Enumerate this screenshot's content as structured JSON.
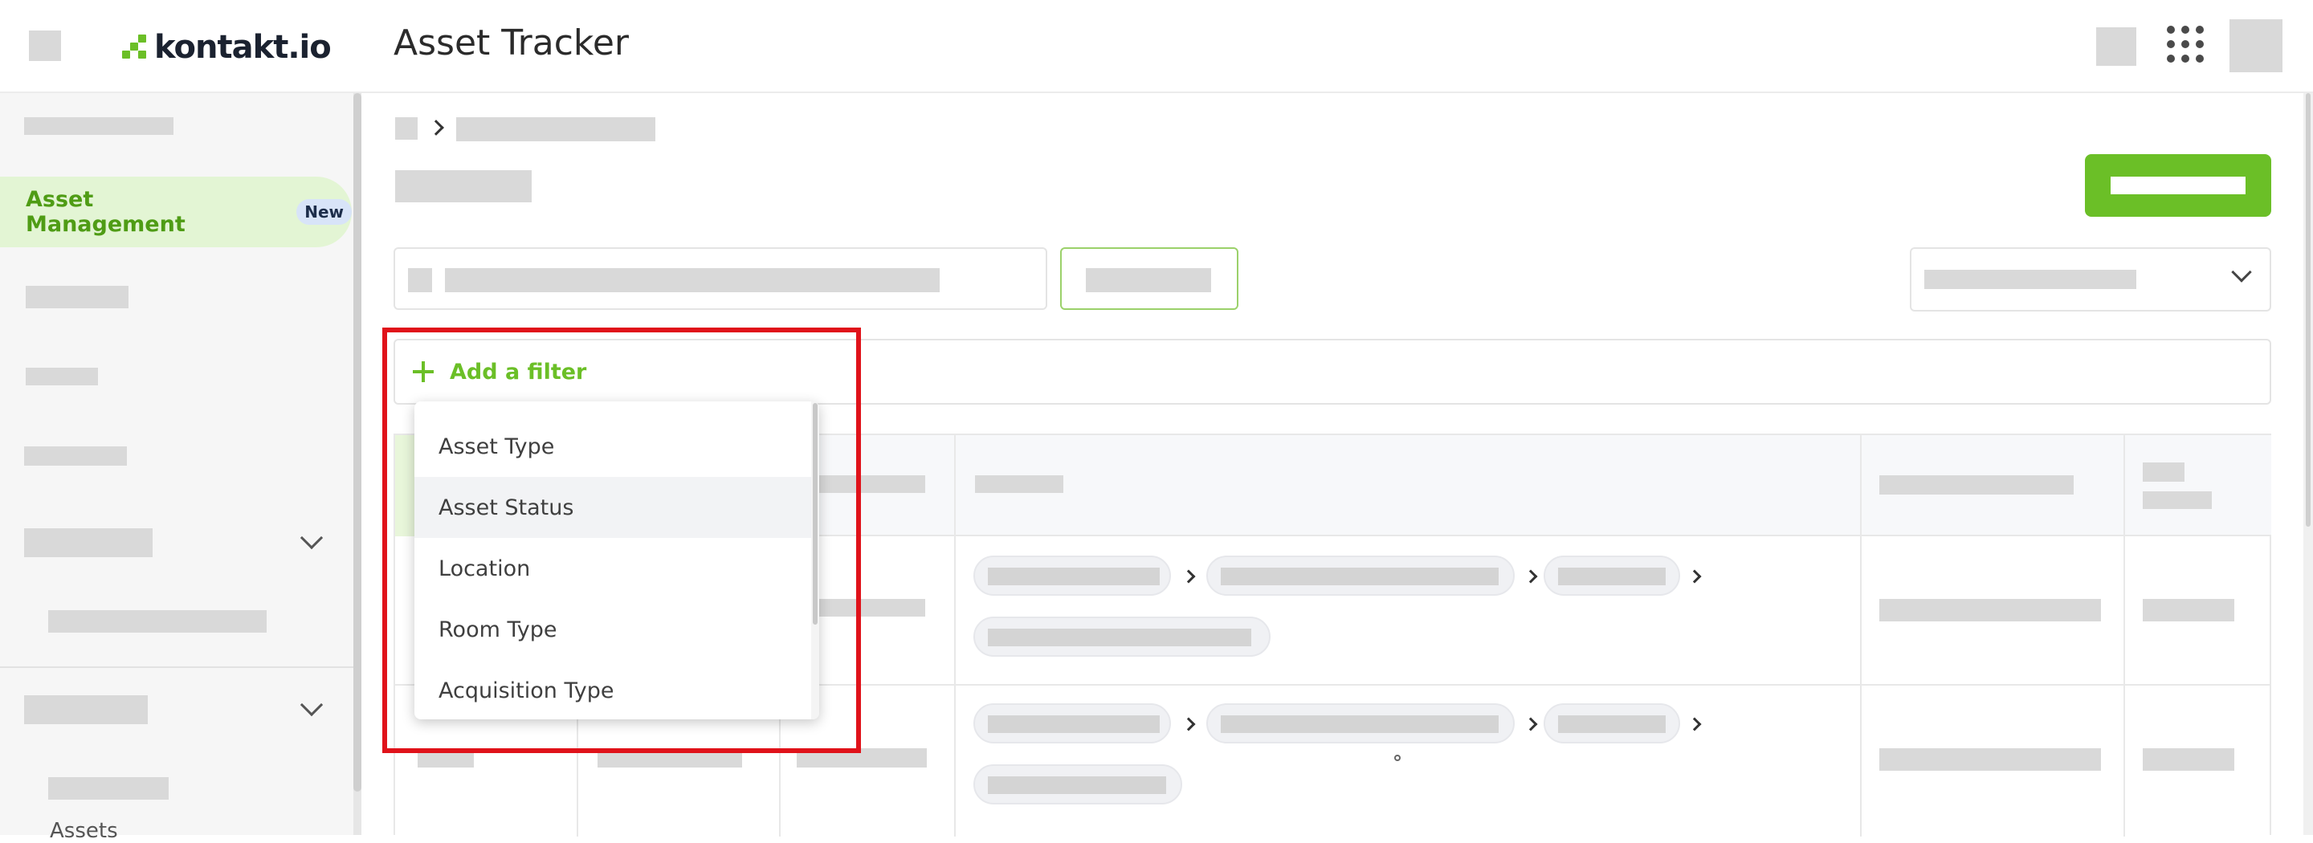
{
  "header": {
    "logo_text": "kontakt.io",
    "app_title": "Asset Tracker"
  },
  "sidebar": {
    "active_item": {
      "label": "Asset Management",
      "badge": "New"
    },
    "partial_item": "Assets"
  },
  "filters": {
    "add_filter_label": "Add a filter"
  },
  "dropdown": {
    "items": [
      "Asset Type",
      "Asset Status",
      "Location",
      "Room Type",
      "Acquisition Type"
    ],
    "highlighted_index": 1
  },
  "colors": {
    "brand_green": "#6bbf27",
    "active_nav_bg": "#e3f5d4",
    "highlight_box": "#e0121a"
  },
  "icons": [
    "menu-icon",
    "apps-grid-icon",
    "user-avatar",
    "plus-icon",
    "chevron-down-icon",
    "chevron-right-icon"
  ]
}
